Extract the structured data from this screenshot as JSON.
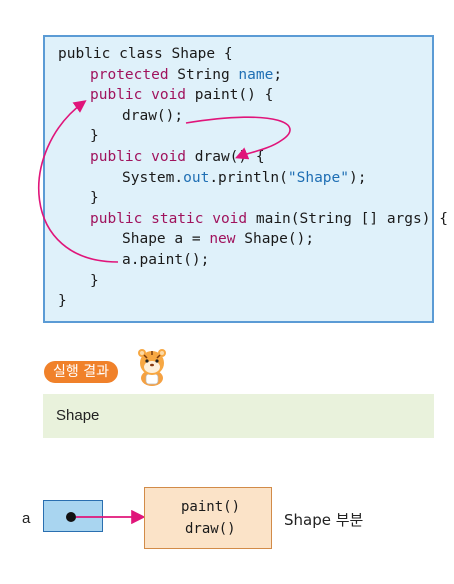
{
  "code": {
    "lines": [
      {
        "segments": [
          {
            "t": "public class Shape {",
            "c": ""
          }
        ]
      },
      {
        "segments": [
          {
            "t": "protected",
            "c": "kw"
          },
          {
            "t": " String ",
            "c": ""
          },
          {
            "t": "name",
            "c": "fld"
          },
          {
            "t": ";",
            "c": ""
          }
        ]
      },
      {
        "segments": [
          {
            "t": "public void",
            "c": "kw"
          },
          {
            "t": " paint() {",
            "c": ""
          }
        ]
      },
      {
        "segments": [
          {
            "t": "draw();",
            "c": ""
          }
        ]
      },
      {
        "segments": [
          {
            "t": "}",
            "c": ""
          }
        ]
      },
      {
        "segments": [
          {
            "t": "public void",
            "c": "kw"
          },
          {
            "t": " draw() {",
            "c": ""
          }
        ]
      },
      {
        "segments": [
          {
            "t": "System.",
            "c": ""
          },
          {
            "t": "out",
            "c": "fld"
          },
          {
            "t": ".println(",
            "c": ""
          },
          {
            "t": "\"Shape\"",
            "c": "str"
          },
          {
            "t": ");",
            "c": ""
          }
        ]
      },
      {
        "segments": [
          {
            "t": "}",
            "c": ""
          }
        ]
      },
      {
        "segments": [
          {
            "t": "public static void",
            "c": "kw"
          },
          {
            "t": " main(String [] args) {",
            "c": ""
          }
        ]
      },
      {
        "segments": [
          {
            "t": "Shape a = ",
            "c": ""
          },
          {
            "t": "new",
            "c": "kw"
          },
          {
            "t": " Shape();",
            "c": ""
          }
        ]
      },
      {
        "segments": [
          {
            "t": "a.paint();",
            "c": ""
          }
        ]
      },
      {
        "segments": [
          {
            "t": "}",
            "c": ""
          }
        ]
      },
      {
        "segments": [
          {
            "t": "}",
            "c": ""
          }
        ]
      }
    ]
  },
  "result": {
    "tag_label": "실행 결과",
    "output": "Shape",
    "mascot_icon": "tiger-mascot-icon"
  },
  "diagram": {
    "variable": "a",
    "methods": [
      "paint()",
      "draw()"
    ],
    "caption": "Shape 부분"
  },
  "colors": {
    "arrow": "#e0157a",
    "keyword": "#a0135d",
    "identifier": "#1f6fb4",
    "code_bg": "#dff1fa",
    "code_border": "#5b9bd5",
    "tag_bg": "#f0812a",
    "result_bg": "#e9f2dc",
    "ref_bg": "#a9d5f0",
    "object_bg": "#fbe3c8"
  }
}
